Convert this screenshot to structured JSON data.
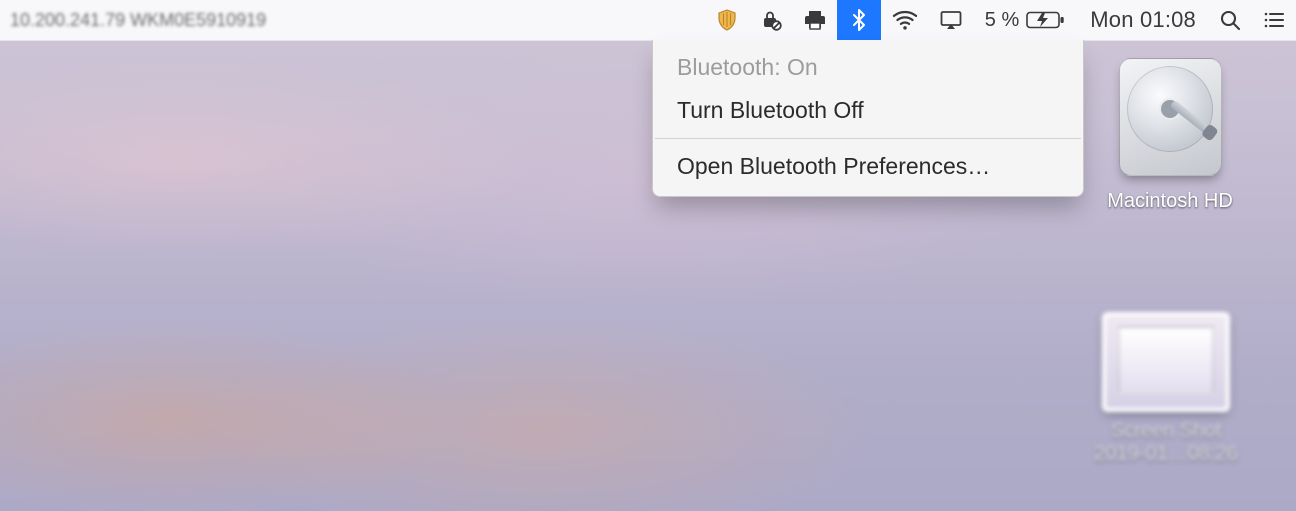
{
  "menubar": {
    "left_text": "10.200.241.79 WKM0E5910919",
    "battery_pct": "5 %",
    "clock": "Mon 01:08"
  },
  "bluetooth_menu": {
    "status": "Bluetooth: On",
    "toggle": "Turn Bluetooth Off",
    "prefs": "Open Bluetooth Preferences…"
  },
  "desktop_icons": {
    "hd_label": "Macintosh HD",
    "screenshot_label": "Screen Shot 2019-01…08:26"
  }
}
